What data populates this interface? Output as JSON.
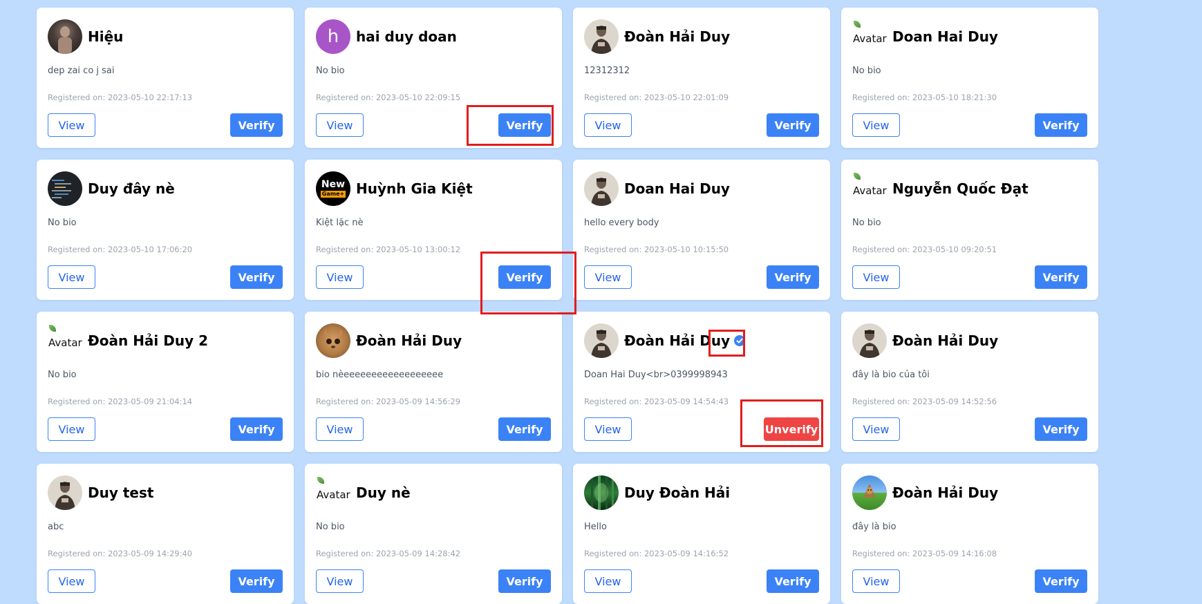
{
  "labels": {
    "view": "View",
    "verify": "Verify",
    "unverify": "Unverify",
    "broken_avatar_alt": "Avatar"
  },
  "users": [
    {
      "name": "Hiệu",
      "bio": "dep zai co j sai",
      "registered": "Registered on: 2023-05-10 22:17:13",
      "avatar": "photo-dark",
      "verified": false
    },
    {
      "name": "hai duy doan",
      "bio": "No bio",
      "registered": "Registered on: 2023-05-10 22:09:15",
      "avatar": "letter",
      "letter": "h",
      "avatar_color": "#a855c7",
      "verified": false
    },
    {
      "name": "Đoàn Hải Duy",
      "bio": "12312312",
      "registered": "Registered on: 2023-05-10 22:01:09",
      "avatar": "photo-person",
      "verified": false
    },
    {
      "name": "Doan Hai Duy",
      "bio": "No bio",
      "registered": "Registered on: 2023-05-10 18:21:30",
      "avatar": "broken",
      "verified": false
    },
    {
      "name": "Duy đây nè",
      "bio": "No bio",
      "registered": "Registered on: 2023-05-10 17:06:20",
      "avatar": "photo-code",
      "verified": false
    },
    {
      "name": "Huỳnh Gia Kiệt",
      "bio": "Kiệt lặc nè",
      "registered": "Registered on: 2023-05-10 13:00:12",
      "avatar": "new-game",
      "avatar_text": "New",
      "avatar_subtext": "Game+",
      "verified": false
    },
    {
      "name": "Doan Hai Duy",
      "bio": "hello every body",
      "registered": "Registered on: 2023-05-10 10:15:50",
      "avatar": "photo-person",
      "verified": false
    },
    {
      "name": "Nguyễn Quốc Đạt",
      "bio": "No bio",
      "registered": "Registered on: 2023-05-10 09:20:51",
      "avatar": "broken",
      "verified": false
    },
    {
      "name": "Đoàn Hải Duy 2",
      "bio": "No bio",
      "registered": "Registered on: 2023-05-09 21:04:14",
      "avatar": "broken",
      "verified": false
    },
    {
      "name": "Đoàn Hải Duy",
      "bio": "bio nèeeeeeeeeeeeeeeeeee",
      "registered": "Registered on: 2023-05-09 14:56:29",
      "avatar": "photo-cat",
      "verified": false
    },
    {
      "name": "Đoàn Hải Duy",
      "bio": "Doan Hai Duy<br>0399998943",
      "registered": "Registered on: 2023-05-09 14:54:43",
      "avatar": "photo-person",
      "verified": true
    },
    {
      "name": "Đoàn Hải Duy",
      "bio": "đây là bio của tôi",
      "registered": "Registered on: 2023-05-09 14:52:56",
      "avatar": "photo-person",
      "verified": false
    },
    {
      "name": "Duy test",
      "bio": "abc",
      "registered": "Registered on: 2023-05-09 14:29:40",
      "avatar": "photo-person",
      "verified": false
    },
    {
      "name": "Duy nè",
      "bio": "No bio",
      "registered": "Registered on: 2023-05-09 14:28:42",
      "avatar": "broken",
      "verified": false
    },
    {
      "name": "Duy Đoàn Hải",
      "bio": "Hello",
      "registered": "Registered on: 2023-05-09 14:16:52",
      "avatar": "photo-forest",
      "verified": false
    },
    {
      "name": "Đoàn Hải Duy",
      "bio": "đây là bio",
      "registered": "Registered on: 2023-05-09 14:16:08",
      "avatar": "photo-landscape",
      "verified": false
    }
  ],
  "colors": {
    "page_background": "#bfdbfe",
    "primary": "#3b82f6",
    "danger": "#ef4444",
    "highlight": "#e11d1d",
    "verified_badge": "#3b82f6"
  },
  "annotations": {
    "highlighted_elements": [
      "verify-button on card 2",
      "verify-button on card 6",
      "verified-badge-icon on card 11",
      "unverify-button on card 11"
    ]
  }
}
